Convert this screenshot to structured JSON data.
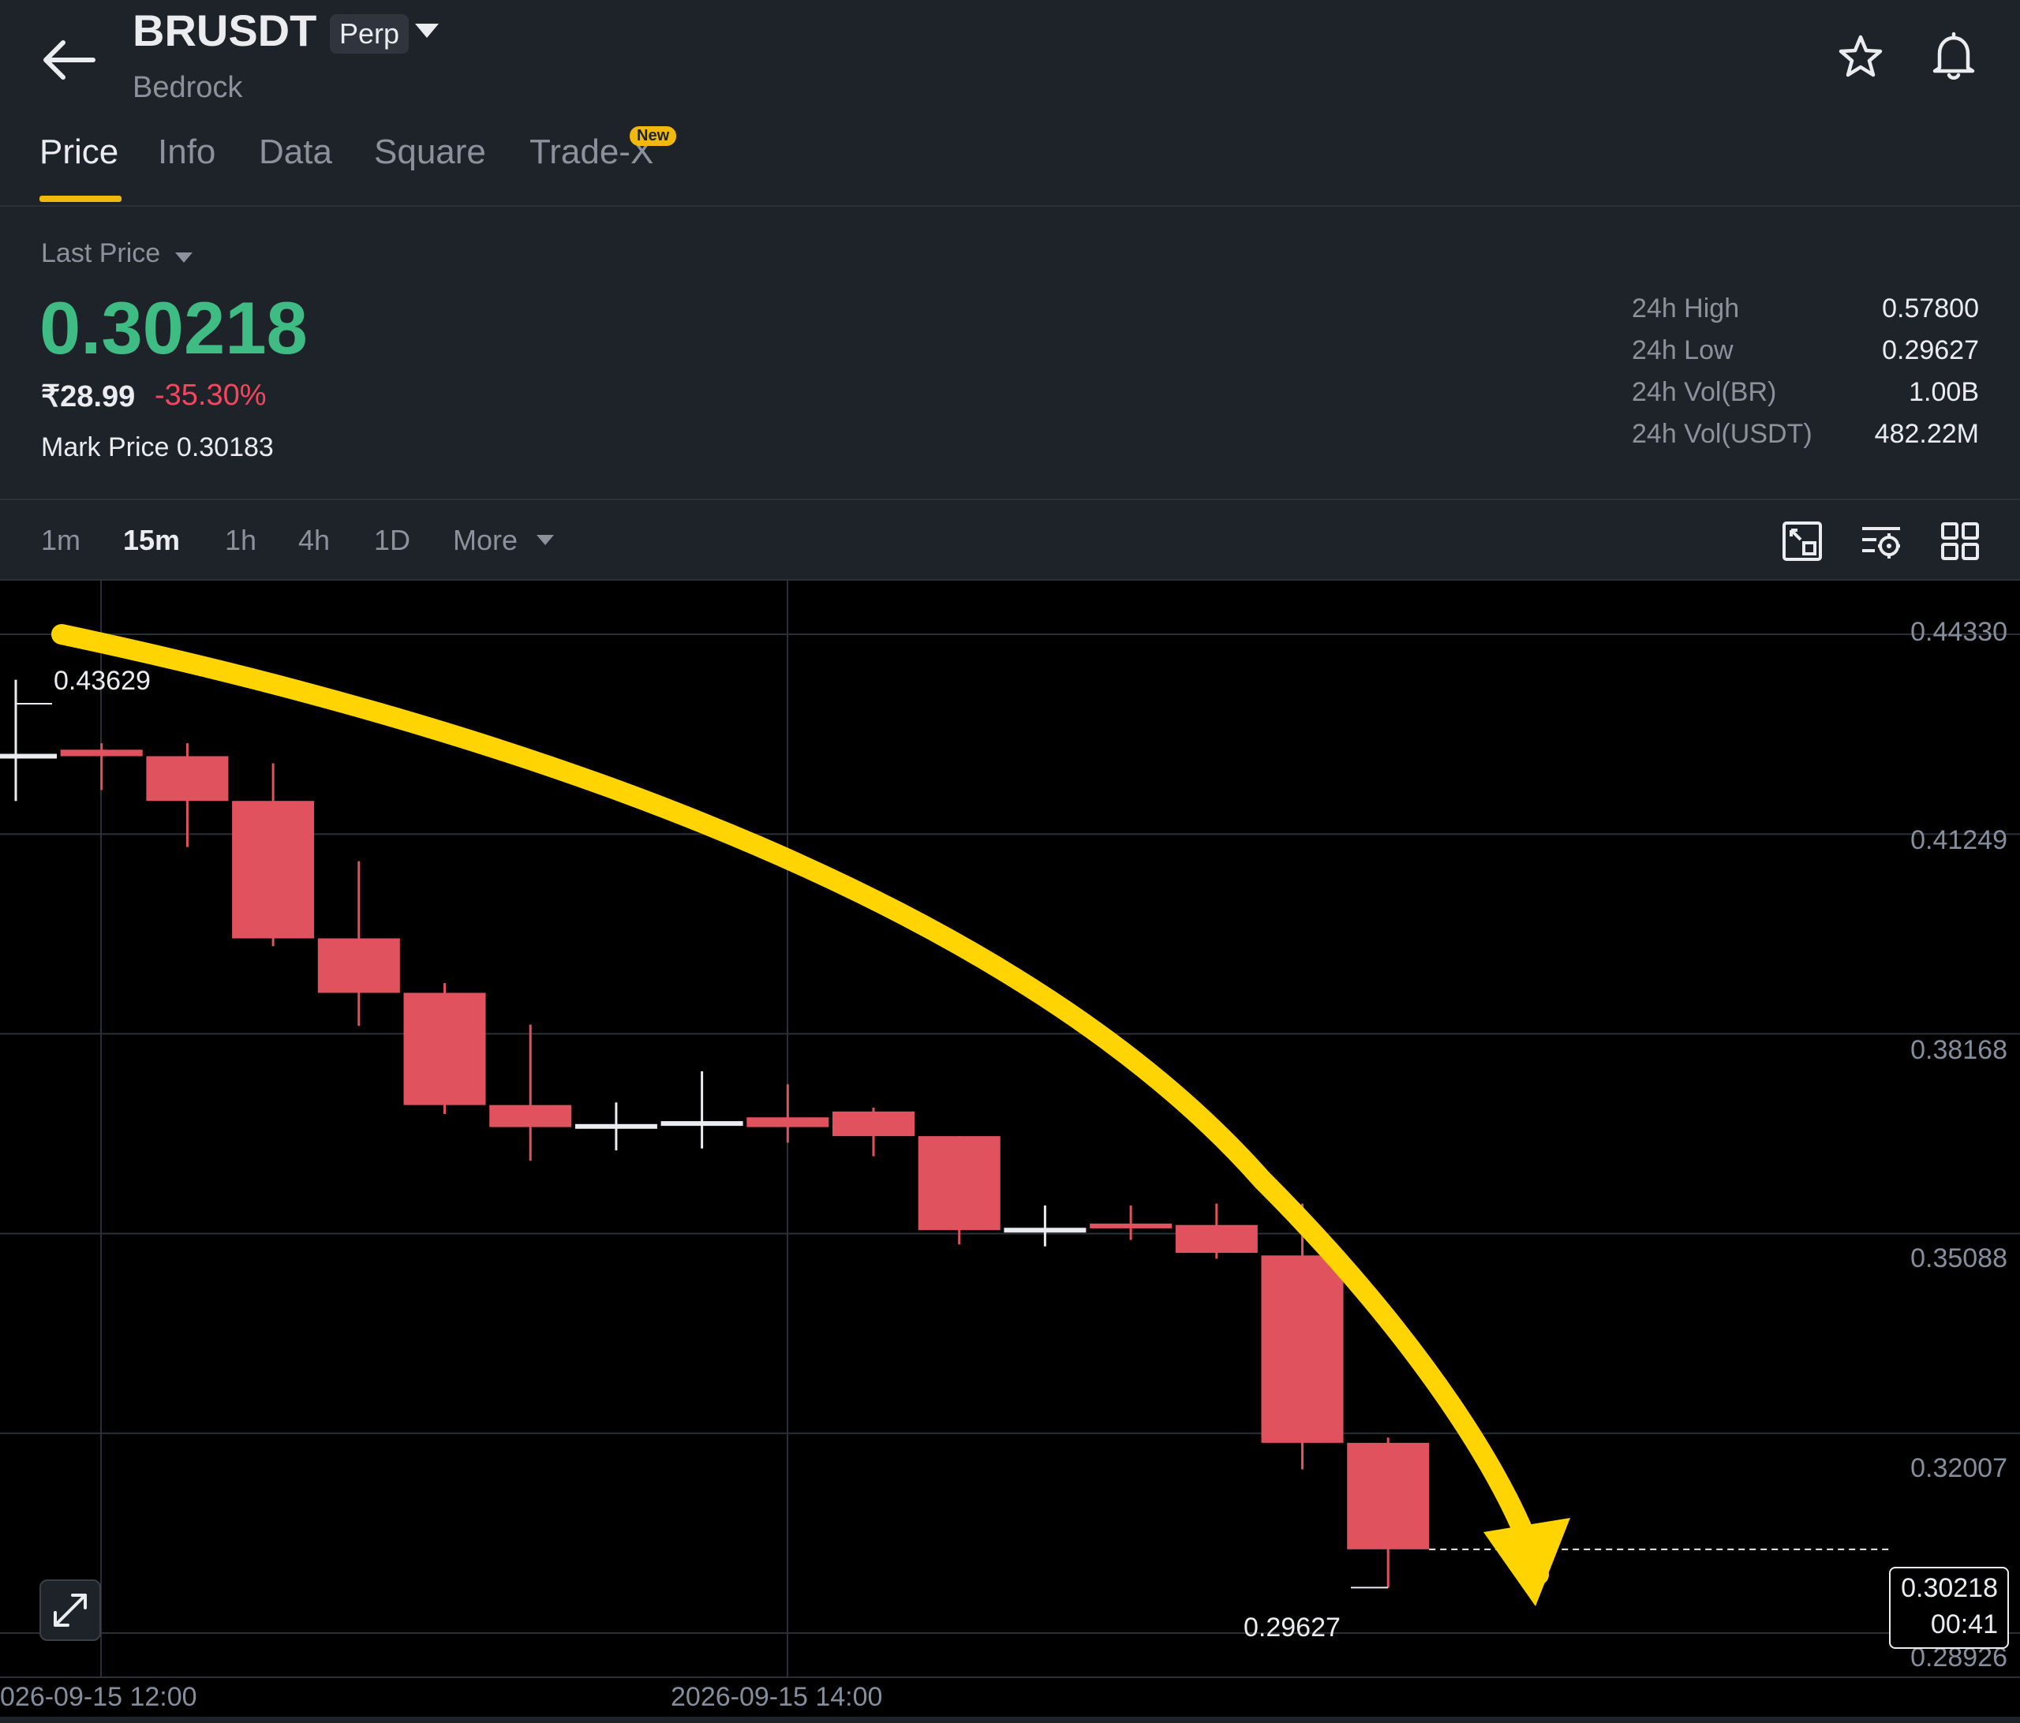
{
  "header": {
    "symbol": "BRUSDT",
    "badge": "Perp",
    "subtitle": "Bedrock",
    "tabs": [
      {
        "label": "Price",
        "active": true
      },
      {
        "label": "Info",
        "active": false
      },
      {
        "label": "Data",
        "active": false
      },
      {
        "label": "Square",
        "active": false
      },
      {
        "label": "Trade-X",
        "active": false
      }
    ],
    "new_badge": "New",
    "icons": [
      "back-arrow-icon",
      "star-icon",
      "bell-icon"
    ]
  },
  "ticker": {
    "last_price_label": "Last Price",
    "last_price": "0.30218",
    "fiat_price": "₹28.99",
    "change": "-35.30%",
    "mark_price_label": "Mark Price",
    "mark_price": "0.30183",
    "stats": [
      {
        "label": "24h High",
        "value": "0.57800"
      },
      {
        "label": "24h Low",
        "value": "0.29627"
      },
      {
        "label": "24h Vol(BR)",
        "value": "1.00B"
      },
      {
        "label": "24h Vol(USDT)",
        "value": "482.22M"
      }
    ],
    "colors": {
      "up": "#3fbc84",
      "down": "#f6465d",
      "accent": "#f0b90b"
    }
  },
  "toolbar": {
    "intervals": [
      {
        "label": "1m",
        "active": false
      },
      {
        "label": "15m",
        "active": true
      },
      {
        "label": "1h",
        "active": false
      },
      {
        "label": "4h",
        "active": false
      },
      {
        "label": "1D",
        "active": false
      }
    ],
    "more_label": "More",
    "icons": [
      "chart-layout-icon",
      "indicator-settings-icon",
      "grid-view-icon"
    ]
  },
  "chart": {
    "y_labels": [
      "0.44330",
      "0.41249",
      "0.38168",
      "0.35088",
      "0.32007",
      "0.28926"
    ],
    "x_labels": [
      "026-09-15 12:00",
      "2026-09-15 14:00"
    ],
    "high_marker": "0.43629",
    "low_marker": "0.29627",
    "current_price": "0.30218",
    "countdown": "00:41"
  },
  "chart_data": {
    "type": "candlestick",
    "interval": "15m",
    "ylim": [
      0.28926,
      0.4433
    ],
    "y_ticks": [
      0.4433,
      0.41249,
      0.38168,
      0.35088,
      0.32007,
      0.28926
    ],
    "x_ticks": [
      "2026-09-15 12:00",
      "2026-09-15 14:00"
    ],
    "candles": [
      {
        "o": 0.4245,
        "h": 0.43629,
        "l": 0.4176,
        "c": 0.4245
      },
      {
        "o": 0.4255,
        "h": 0.4265,
        "l": 0.4193,
        "c": 0.4245
      },
      {
        "o": 0.4245,
        "h": 0.4265,
        "l": 0.4105,
        "c": 0.4176
      },
      {
        "o": 0.4176,
        "h": 0.4234,
        "l": 0.3952,
        "c": 0.3964
      },
      {
        "o": 0.3964,
        "h": 0.4083,
        "l": 0.3829,
        "c": 0.388
      },
      {
        "o": 0.388,
        "h": 0.3895,
        "l": 0.3693,
        "c": 0.3707
      },
      {
        "o": 0.3707,
        "h": 0.3831,
        "l": 0.3621,
        "c": 0.3673
      },
      {
        "o": 0.3674,
        "h": 0.3711,
        "l": 0.3637,
        "c": 0.3674
      },
      {
        "o": 0.3677,
        "h": 0.3759,
        "l": 0.364,
        "c": 0.368
      },
      {
        "o": 0.3688,
        "h": 0.3739,
        "l": 0.3649,
        "c": 0.3673
      },
      {
        "o": 0.3697,
        "h": 0.3703,
        "l": 0.3628,
        "c": 0.3659
      },
      {
        "o": 0.3659,
        "h": 0.3659,
        "l": 0.3492,
        "c": 0.3514
      },
      {
        "o": 0.3514,
        "h": 0.3552,
        "l": 0.3489,
        "c": 0.3514
      },
      {
        "o": 0.3522,
        "h": 0.3552,
        "l": 0.3499,
        "c": 0.3519
      },
      {
        "o": 0.3522,
        "h": 0.3555,
        "l": 0.347,
        "c": 0.3479
      },
      {
        "o": 0.3475,
        "h": 0.3555,
        "l": 0.3145,
        "c": 0.3186
      },
      {
        "o": 0.3186,
        "h": 0.3194,
        "l": 0.29627,
        "c": 0.30218
      }
    ],
    "last_price": 0.30218
  }
}
